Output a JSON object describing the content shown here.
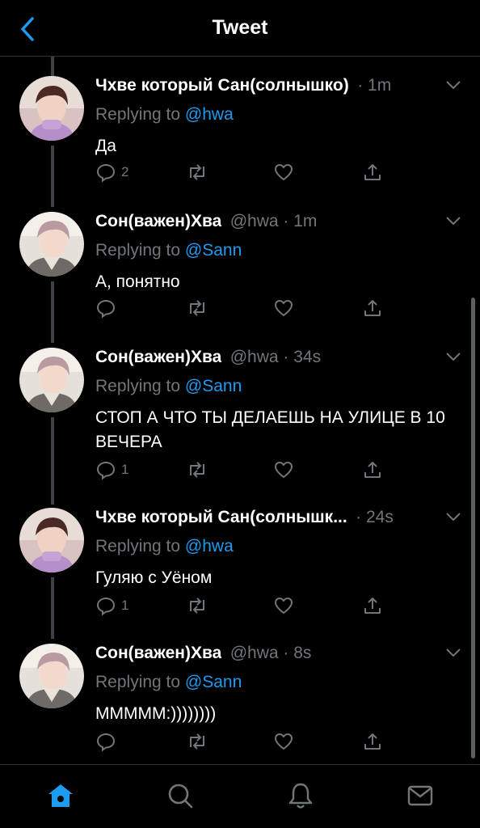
{
  "header": {
    "title": "Tweet",
    "back_icon": "chevron-left-icon"
  },
  "colors": {
    "accent": "#1d9bf0",
    "muted": "#71767b",
    "background": "#000000",
    "thread_line": "#3d4144"
  },
  "tweets": [
    {
      "name": "Чхве который Сан(солнышко)",
      "meta": "· 1m",
      "replying_prefix": "Replying to",
      "replying_handle": "@hwa",
      "text": "Да",
      "reply_count": "2",
      "avatar": "san-avatar"
    },
    {
      "name": "Сон(важен)Хва",
      "meta": "@hwa · 1m",
      "replying_prefix": "Replying to",
      "replying_handle": "@Sann",
      "text": "А, понятно",
      "reply_count": "",
      "avatar": "hwa-avatar"
    },
    {
      "name": "Сон(важен)Хва",
      "meta": "@hwa · 34s",
      "replying_prefix": "Replying to",
      "replying_handle": "@Sann",
      "text": "СТОП А ЧТО ТЫ ДЕЛАЕШЬ НА УЛИЦЕ В 10 ВЕЧЕРА",
      "reply_count": "1",
      "avatar": "hwa-avatar"
    },
    {
      "name": "Чхве который Сан(солнышк...",
      "meta": "· 24s",
      "replying_prefix": "Replying to",
      "replying_handle": "@hwa",
      "text": "Гуляю с Уёном",
      "reply_count": "1",
      "avatar": "san-avatar"
    },
    {
      "name": "Сон(важен)Хва",
      "meta": "@hwa · 8s",
      "replying_prefix": "Replying to",
      "replying_handle": "@Sann",
      "text": "МММММ:))))))))",
      "reply_count": "",
      "avatar": "hwa-avatar"
    }
  ],
  "tabbar": {
    "items": [
      "home-icon",
      "search-icon",
      "notifications-icon",
      "messages-icon"
    ],
    "active": "home-icon"
  }
}
